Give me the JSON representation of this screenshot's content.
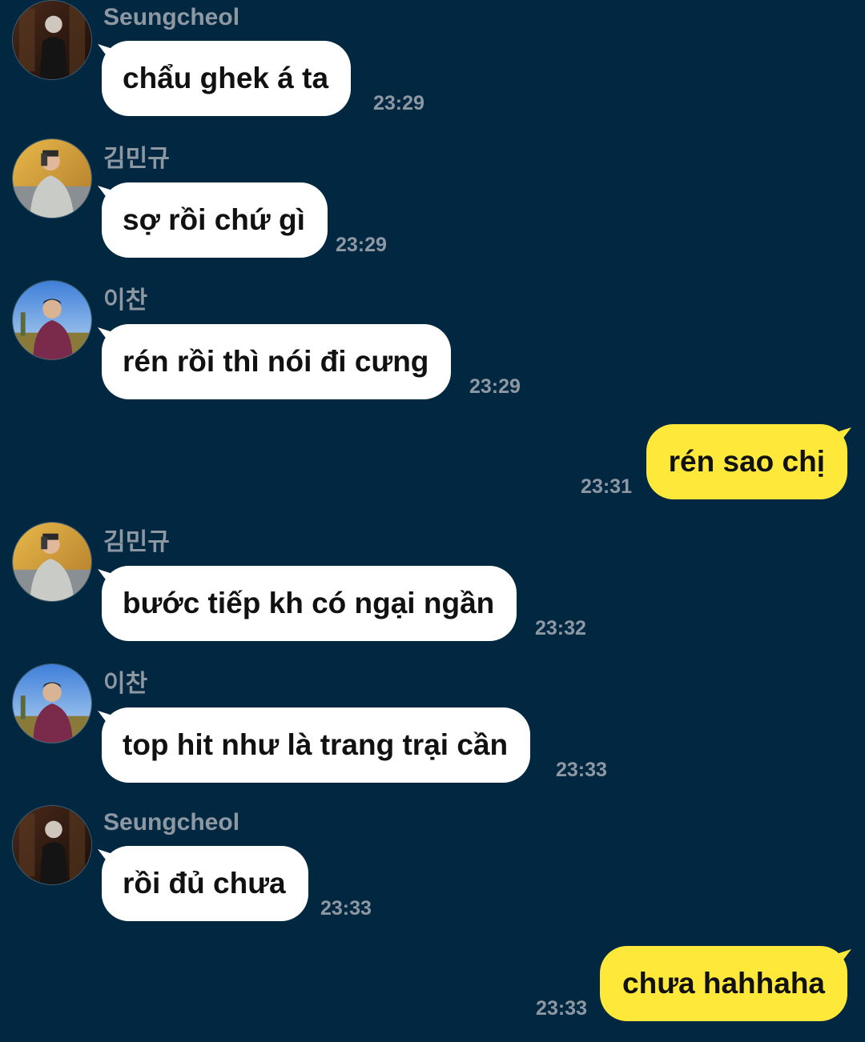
{
  "colors": {
    "background": "#022841",
    "incoming_bubble": "#ffffff",
    "outgoing_bubble": "#fee93b",
    "meta_text": "#8e98a3",
    "message_text": "#111111"
  },
  "messages": [
    {
      "direction": "in",
      "sender": "Seungcheol",
      "avatar": "avatar-seungcheol",
      "text": "chẩu ghek á ta",
      "time": "23:29"
    },
    {
      "direction": "in",
      "sender": "김민규",
      "avatar": "avatar-mingyu",
      "text": "sợ rồi chứ gì",
      "time": "23:29"
    },
    {
      "direction": "in",
      "sender": "이찬",
      "avatar": "avatar-chan",
      "text": "rén rồi thì nói đi cưng",
      "time": "23:29"
    },
    {
      "direction": "out",
      "text": "rén sao chị",
      "time": "23:31"
    },
    {
      "direction": "in",
      "sender": "김민규",
      "avatar": "avatar-mingyu",
      "text": "bước tiếp kh có ngại ngần",
      "time": "23:32"
    },
    {
      "direction": "in",
      "sender": "이찬",
      "avatar": "avatar-chan",
      "text": "top hit như là trang trại cần",
      "time": "23:33"
    },
    {
      "direction": "in",
      "sender": "Seungcheol",
      "avatar": "avatar-seungcheol",
      "text": "rồi đủ chưa",
      "time": "23:33"
    },
    {
      "direction": "out",
      "text": "chưa hahhaha",
      "time": "23:33"
    }
  ]
}
